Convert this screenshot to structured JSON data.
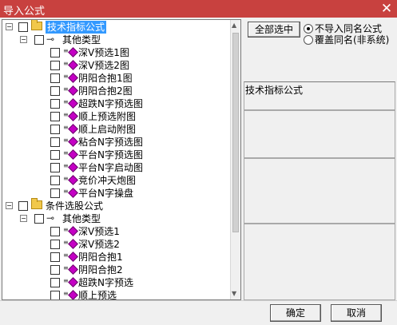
{
  "window": {
    "title": "导入公式",
    "close_glyph": "✕"
  },
  "tree": {
    "expand_glyph": "−",
    "icons": {
      "folder": "folder-icon",
      "key": "key-icon",
      "function": "function-icon",
      "diamond": "formula-diamond-icon"
    },
    "key_glyph": "⊸",
    "fn_glyph": "≡",
    "groups": [
      {
        "label": "技术指标公式",
        "selected": true,
        "type_label": "其他类型",
        "items": [
          "深V预选1图",
          "深V预选2图",
          "阴阳合抱1图",
          "阴阳合抱2图",
          "超跌N字预选图",
          "顺上预选附图",
          "顺上启动附图",
          "粘合N字预选图",
          "平台N字预选图",
          "平台N字启动图",
          "竞价冲天炮图",
          "平台N字操盘"
        ]
      },
      {
        "label": "条件选股公式",
        "selected": false,
        "type_label": "其他类型",
        "items": [
          "深V预选1",
          "深V预选2",
          "阴阳合抱1",
          "阴阳合抱2",
          "超跌N字预选",
          "顺上预选"
        ]
      }
    ]
  },
  "right": {
    "select_all_label": "全部选中",
    "options": [
      {
        "label": "不导入同名公式",
        "checked": true
      },
      {
        "label": "覆盖同名(非系统)",
        "checked": false
      }
    ],
    "info_label": "技术指标公式"
  },
  "footer": {
    "ok_label": "确定",
    "cancel_label": "取消"
  },
  "colors": {
    "title_bar": "#c8413f",
    "selection": "#3399ff",
    "diamond": "#c400c4",
    "folder": "#f1c84b"
  }
}
